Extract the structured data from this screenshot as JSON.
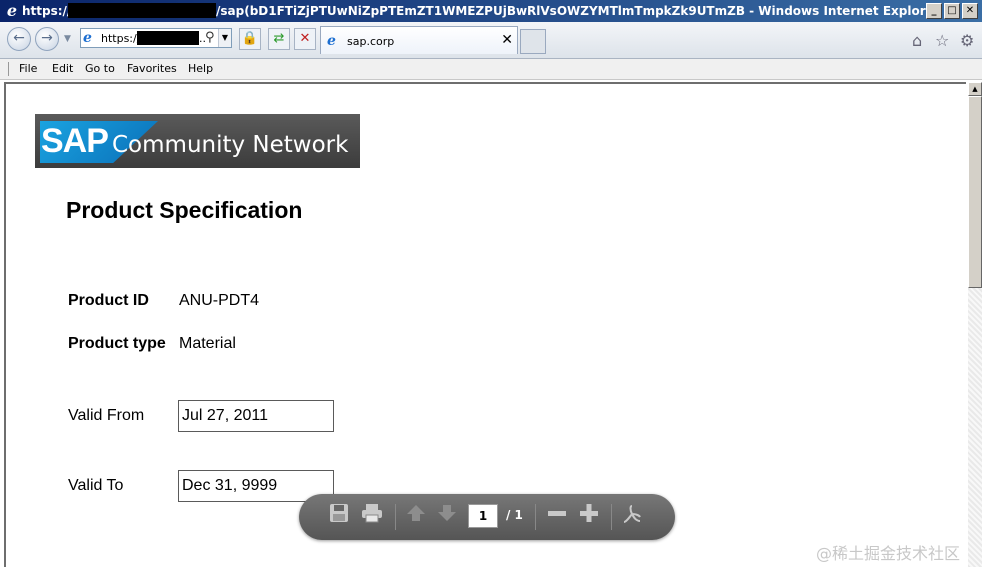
{
  "window": {
    "title_prefix": "https://",
    "title_rest": "/sap(bD1FTiZjPTUwNiZpPTEmZT1WMEZPUjBwRlVsOWZYMTlmTmpkZk9UTmZB - Windows Internet Explorer",
    "min_label": "_",
    "max_label": "□",
    "close_label": "✕"
  },
  "address": {
    "prefix": "https://",
    "dots": ".."
  },
  "tab": {
    "label": "sap.corp",
    "close": "✕"
  },
  "menu": [
    "File",
    "Edit",
    "Go to",
    "Favorites",
    "Help"
  ],
  "page": {
    "title": "Product Specification",
    "logo_text_sap": "SAP",
    "logo_text_network": "Community Network",
    "product_id_label": "Product ID",
    "product_id_value": "ANU-PDT4",
    "product_type_label": "Product type",
    "product_type_value": "Material",
    "valid_from_label": "Valid From",
    "valid_from_value": "Jul 27, 2011",
    "valid_to_label": "Valid To",
    "valid_to_value": "Dec 31, 9999"
  },
  "pdf_toolbar": {
    "page_current": "1",
    "page_total": "/ 1"
  },
  "watermark": "@稀土掘金技术社区"
}
